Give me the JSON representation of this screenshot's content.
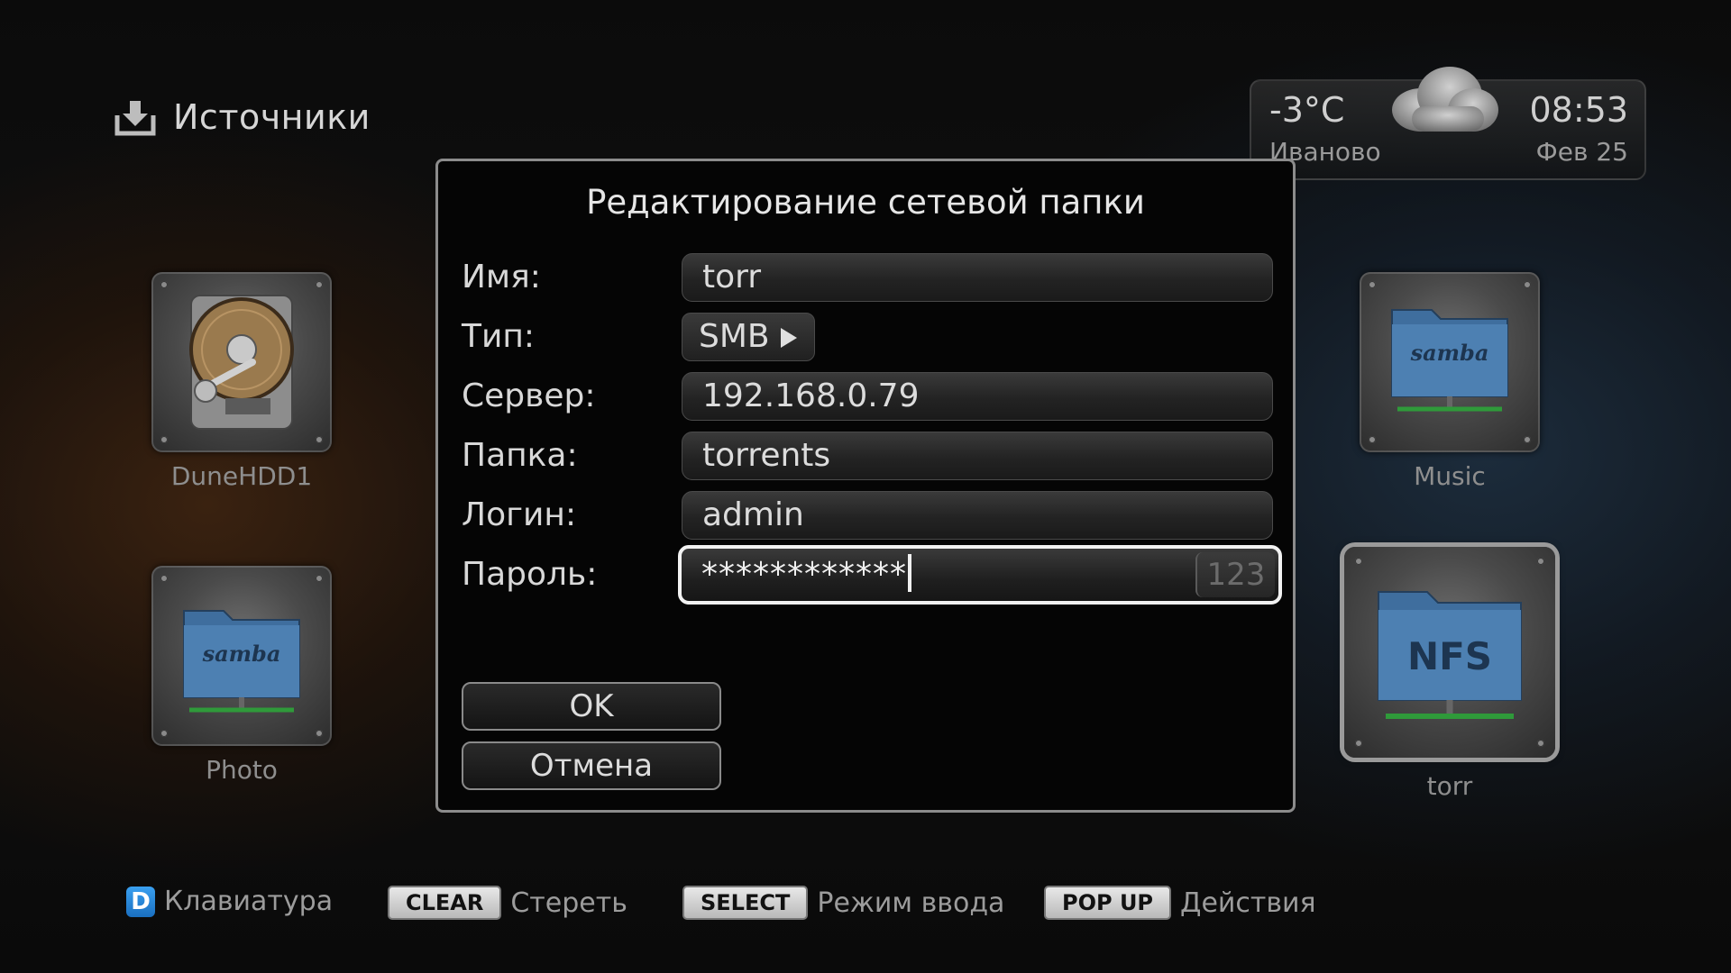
{
  "header": {
    "title": "Источники",
    "icon": "download-tray-icon"
  },
  "weather": {
    "temperature": "-3°C",
    "time": "08:53",
    "city": "Иваново",
    "date": "Фев 25",
    "icon": "cloud-icon"
  },
  "tiles": [
    {
      "label": "DuneHDD1",
      "icon": "hard-drive-icon"
    },
    {
      "label": "Photo",
      "icon": "samba-folder-icon",
      "icon_text": "samba"
    },
    {
      "label": "Music",
      "icon": "samba-folder-icon",
      "icon_text": "samba"
    },
    {
      "label": "torr",
      "icon": "nfs-folder-icon",
      "icon_text": "NFS",
      "selected": true
    }
  ],
  "dialog": {
    "title": "Редактирование сетевой папки",
    "fields": {
      "name": {
        "label": "Имя:",
        "value": "torr"
      },
      "type": {
        "label": "Тип:",
        "value": "SMB"
      },
      "server": {
        "label": "Сервер:",
        "value": "192.168.0.79"
      },
      "folder": {
        "label": "Папка:",
        "value": "torrents"
      },
      "login": {
        "label": "Логин:",
        "value": "admin"
      },
      "password": {
        "label": "Пароль:",
        "value": "************",
        "input_mode": "123"
      }
    },
    "buttons": {
      "ok": "OK",
      "cancel": "Отмена"
    }
  },
  "footer": {
    "keyboard": {
      "key": "D",
      "label": "Клавиатура"
    },
    "clear": {
      "key": "CLEAR",
      "label": "Стереть"
    },
    "select": {
      "key": "SELECT",
      "label": "Режим ввода"
    },
    "popup": {
      "key": "POP UP",
      "label": "Действия"
    }
  }
}
